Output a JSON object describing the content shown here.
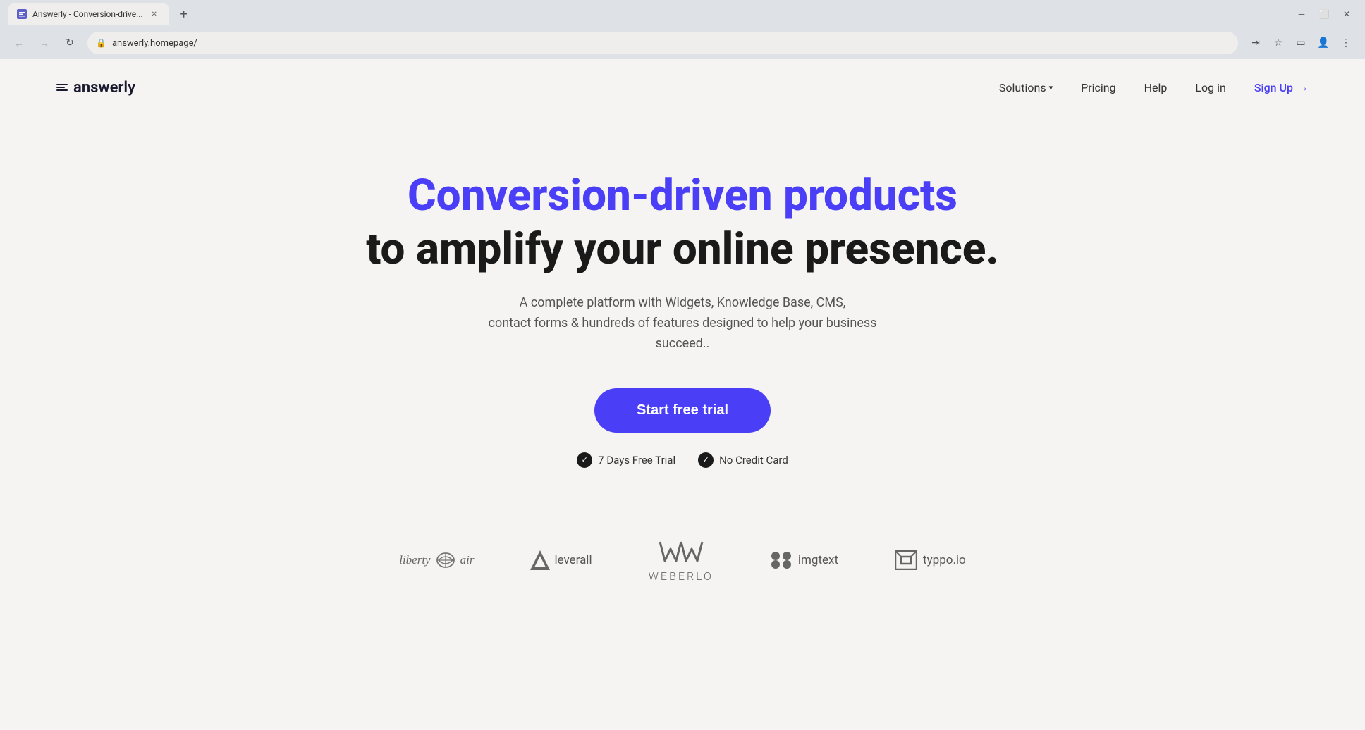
{
  "browser": {
    "tab_title": "Answerly - Conversion-drive...",
    "url": "answerly.homepage/",
    "new_tab_icon": "+",
    "back_disabled": true,
    "forward_disabled": true
  },
  "nav": {
    "logo_text": "answerly",
    "solutions_label": "Solutions",
    "pricing_label": "Pricing",
    "help_label": "Help",
    "login_label": "Log in",
    "signup_label": "Sign Up"
  },
  "hero": {
    "title_line1": "Conversion-driven products",
    "title_line2": "to amplify your online presence.",
    "subtitle_line1": "A complete platform with Widgets, Knowledge Base, CMS,",
    "subtitle_line2": "contact forms & hundreds of features designed to help your business succeed..",
    "cta_label": "Start free trial",
    "badge1": "7 Days Free Trial",
    "badge2": "No Credit Card"
  },
  "logos": {
    "items": [
      {
        "name": "liberty air"
      },
      {
        "name": "leverall"
      },
      {
        "name": "Weberlo"
      },
      {
        "name": "imgtext"
      },
      {
        "name": "typpo.io"
      }
    ]
  },
  "colors": {
    "accent": "#4a3ff7",
    "dark": "#1a1a1a",
    "muted": "#555555"
  }
}
